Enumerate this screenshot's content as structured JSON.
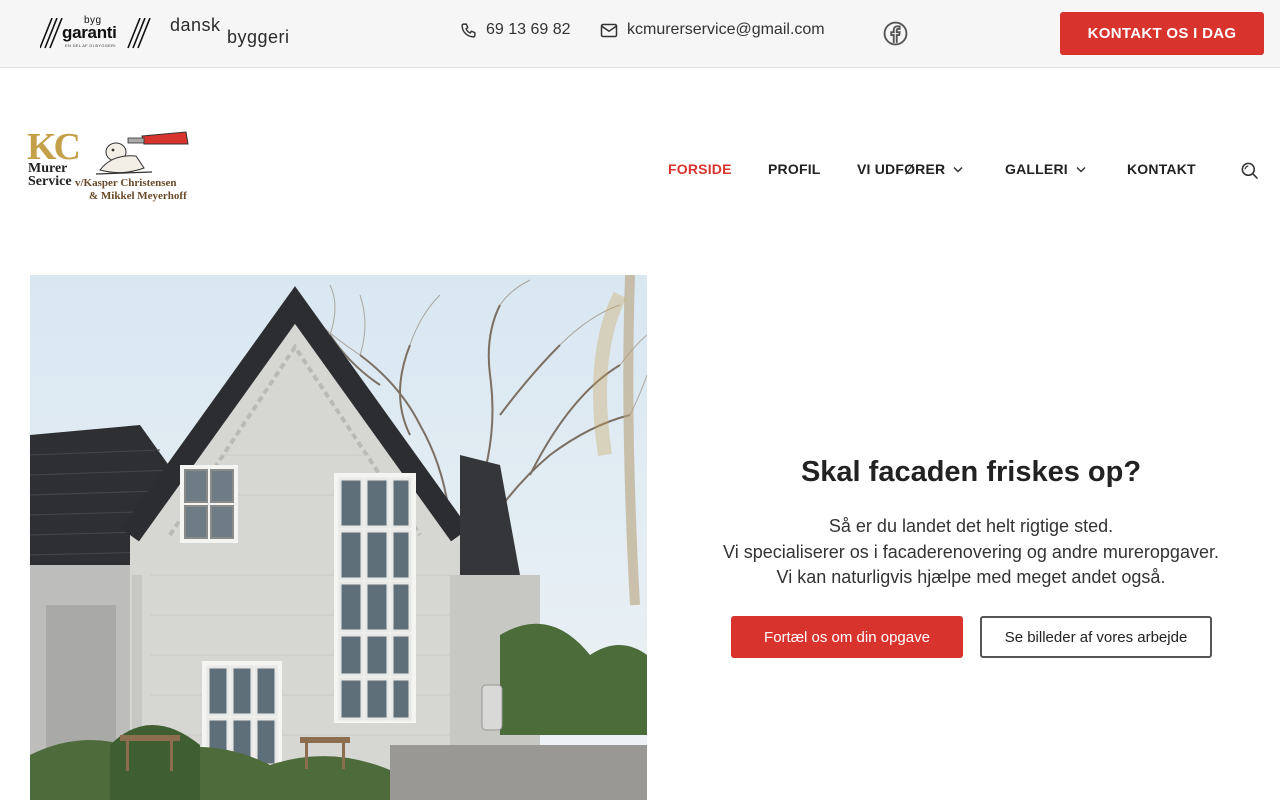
{
  "topbar": {
    "partner_logos": {
      "byggaranti": {
        "line1": "byg",
        "line2": "garanti",
        "tagline": "EN DEL AF DI BYGGERI"
      },
      "danskbyggeri": {
        "line1": "dansk",
        "line2": "byggeri"
      }
    },
    "phone": "69 13 69 82",
    "email": "kcmurerservice@gmail.com",
    "facebook_icon": "facebook-icon",
    "cta_label": "KONTAKT OS I DAG"
  },
  "brand": {
    "kc": "KC",
    "murer": "Murer",
    "service": "Service",
    "owner_line1": "v/Kasper Christensen",
    "owner_line2": "& Mikkel Meyerhoff"
  },
  "nav": {
    "items": [
      {
        "label": "FORSIDE",
        "active": true,
        "has_dropdown": false
      },
      {
        "label": "PROFIL",
        "active": false,
        "has_dropdown": false
      },
      {
        "label": "VI UDFØRER",
        "active": false,
        "has_dropdown": true
      },
      {
        "label": "GALLERI",
        "active": false,
        "has_dropdown": true
      },
      {
        "label": "KONTAKT",
        "active": false,
        "has_dropdown": false
      }
    ],
    "search_icon": "search-icon"
  },
  "hero": {
    "title": "Skal facaden friskes op?",
    "lines": [
      "Så er du landet det helt rigtige sted.",
      "Vi specialiserer os i facaderenovering og andre mureropgaver.",
      "Vi kan naturligvis hjælpe med meget andet også."
    ],
    "primary_button": "Fortæl os om din opgave",
    "secondary_button": "Se billeder af vores arbejde"
  },
  "colors": {
    "accent": "#d8332d",
    "topbar_bg": "#f6f6f6",
    "text": "#222222"
  }
}
